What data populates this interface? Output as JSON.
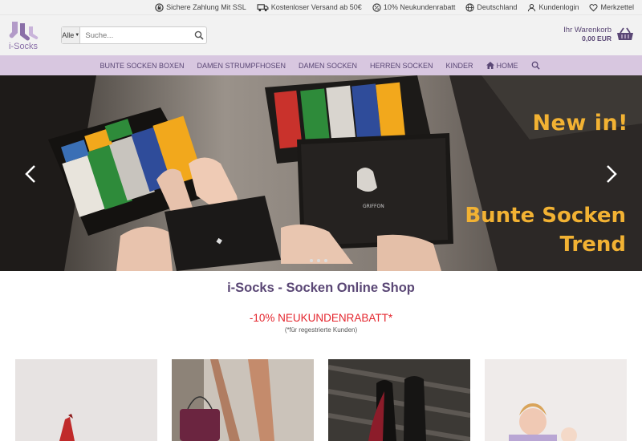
{
  "topbar": {
    "items": [
      {
        "label": "Sichere Zahlung Mit SSL",
        "icon": "shield-lock-icon"
      },
      {
        "label": "Kostenloser Versand ab 50€",
        "icon": "truck-icon"
      },
      {
        "label": "10% Neukundenrabatt",
        "icon": "percent-icon"
      },
      {
        "label": "Deutschland",
        "icon": "globe-icon"
      },
      {
        "label": "Kundenlogin",
        "icon": "user-icon"
      },
      {
        "label": "Merkzettel",
        "icon": "heart-icon"
      }
    ]
  },
  "header": {
    "logo_text": "i-Socks",
    "search": {
      "category": "Alle",
      "placeholder": "Suche..."
    },
    "cart": {
      "label": "Ihr Warenkorb",
      "total": "0,00 EUR"
    }
  },
  "nav": {
    "items": [
      "BUNTE SOCKEN BOXEN",
      "DAMEN STRUMPFHOSEN",
      "DAMEN SOCKEN",
      "HERREN SOCKEN",
      "KINDER"
    ],
    "home": "HOME"
  },
  "hero": {
    "headline": "New in!",
    "line1": "Bunte Socken",
    "line2": "Trend",
    "slides": 3,
    "accent": "#f2b233"
  },
  "main": {
    "title": "i-Socks - Socken Online Shop",
    "promo": "-10% NEUKUNDENRABATT*",
    "promo_note": "(*für regestrierte Kunden)"
  },
  "colors": {
    "brand": "#5a4775",
    "nav_bg": "#d8c7e0",
    "promo": "#e4252d"
  }
}
